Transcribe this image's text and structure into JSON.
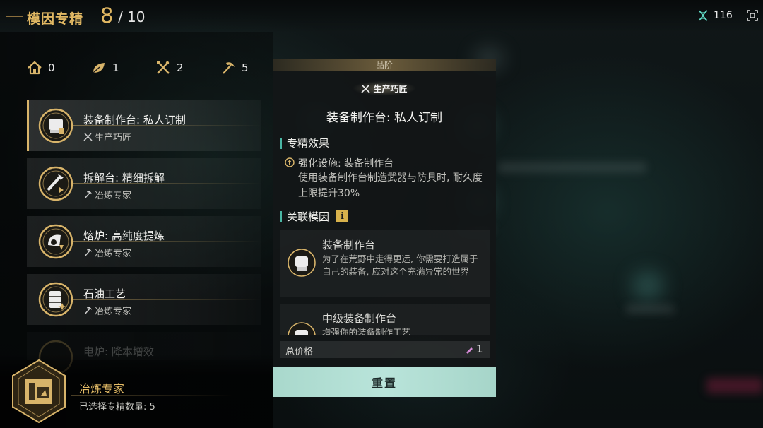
{
  "header": {
    "title": "模因专精",
    "count_current": "8",
    "count_sep": "/",
    "count_total": "10",
    "currency_value": "116",
    "currency_icon": "dna-strand-icon",
    "exit_icon": "exit-icon"
  },
  "tree_stats": [
    {
      "icon": "house-icon",
      "value": "0"
    },
    {
      "icon": "leaf-icon",
      "value": "1"
    },
    {
      "icon": "crossed-tools-icon",
      "value": "2"
    },
    {
      "icon": "pickaxe-icon",
      "value": "5"
    }
  ],
  "gene_list": [
    {
      "name": "装备制作台: 私人订制",
      "category": "生产巧匠",
      "category_icon": "crossed-tools-icon",
      "selected": true
    },
    {
      "name": "拆解台: 精细拆解",
      "category": "冶炼专家",
      "category_icon": "pickaxe-icon",
      "selected": false
    },
    {
      "name": "熔炉: 高纯度提炼",
      "category": "冶炼专家",
      "category_icon": "pickaxe-icon",
      "selected": false
    },
    {
      "name": "石油工艺",
      "category": "冶炼专家",
      "category_icon": "pickaxe-icon",
      "selected": false
    },
    {
      "name": "电炉: 降本增效",
      "category": "",
      "category_icon": "",
      "selected": false
    }
  ],
  "expert": {
    "name": "冶炼专家",
    "selected_label": "已选择专精数量: 5"
  },
  "detail": {
    "grade_label": "品阶",
    "grade_badge": "生产巧匠",
    "title": "装备制作台: 私人订制",
    "effect_section": "专精效果",
    "effect_title": "强化设施: 装备制作台",
    "effect_desc": "使用装备制作台制造武器与防具时, 耐久度上限提升30%",
    "linked_section": "关联模因",
    "linked_info": "i",
    "linked": [
      {
        "name": "装备制作台",
        "desc": "为了在荒野中走得更远, 你需要打造属于自己的装备, 应对这个充满异常的世界"
      },
      {
        "name": "中级装备制作台",
        "desc": "增强你的装备制作工艺"
      }
    ],
    "price_label": "总价格",
    "price_value": "1",
    "reset_label": "重置"
  },
  "colors": {
    "gold": "#e1b863",
    "teal_accent": "#4ab6a4",
    "reset_button": "#b2ded3"
  }
}
